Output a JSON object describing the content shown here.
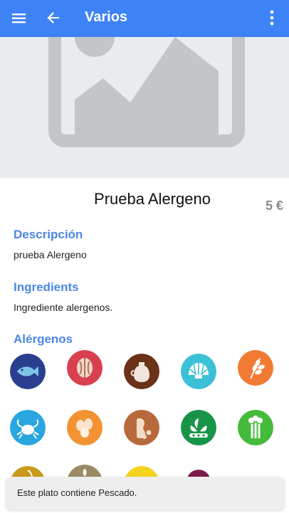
{
  "colors": {
    "primary": "#3d82f6",
    "section_title": "#4a86e8",
    "price": "#8a8a8a",
    "hero_bg": "#e9ecef",
    "placeholder_icon": "#c3c6c9"
  },
  "appbar": {
    "title": "Varios",
    "menu_icon": "hamburger-menu-icon",
    "back_icon": "arrow-back-icon",
    "more_icon": "more-vert-icon"
  },
  "hero": {
    "icon": "image-placeholder-icon"
  },
  "dish": {
    "name": "Prueba Alergeno",
    "price": "5 €"
  },
  "sections": {
    "description": {
      "title": "Descripción",
      "text": "prueba Alergeno"
    },
    "ingredients": {
      "title": "Ingredients",
      "text": "Ingrediente alergenos."
    },
    "allergens": {
      "title": "Alérgenos"
    }
  },
  "allergens": [
    {
      "icon": "fish-icon",
      "color": "#2b3f8f"
    },
    {
      "icon": "nuts-icon",
      "color": "#d8404f"
    },
    {
      "icon": "mustard-icon",
      "color": "#6b3219"
    },
    {
      "icon": "mollusks-icon",
      "color": "#3cc0d6"
    },
    {
      "icon": "gluten-icon",
      "color": "#f27a33"
    },
    {
      "icon": "crustaceans-icon",
      "color": "#29a6e0"
    },
    {
      "icon": "eggs-icon",
      "color": "#f39233"
    },
    {
      "icon": "peanuts-icon",
      "color": "#b8693b"
    },
    {
      "icon": "soy-icon",
      "color": "#179447"
    },
    {
      "icon": "celery-icon",
      "color": "#44bb3a"
    },
    {
      "icon": "lupin-icon",
      "color": "#c99a1c"
    },
    {
      "icon": "sesame-icon",
      "color": "#9a8a66"
    },
    {
      "icon": "dairy-icon",
      "color": "#f4d21e"
    },
    {
      "icon": "sulphites-icon",
      "color": "#7b1a4b"
    }
  ],
  "snackbar": {
    "text": "Este plato contiene Pescado."
  }
}
